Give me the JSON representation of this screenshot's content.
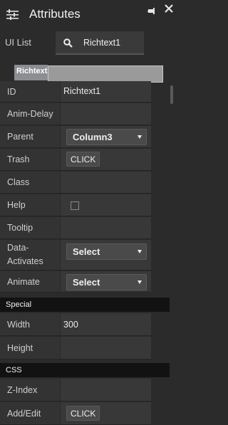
{
  "header": {
    "title": "Attributes"
  },
  "tabs": {
    "ui_list": "UI List",
    "search_value": "Richtext1"
  },
  "name_tag": "Richtext",
  "props": {
    "id": {
      "label": "ID",
      "value": "Richtext1"
    },
    "anim_delay": {
      "label": "Anim-Delay",
      "value": ""
    },
    "parent": {
      "label": "Parent",
      "value": "Column3"
    },
    "trash": {
      "label": "Trash",
      "button": "CLICK"
    },
    "class": {
      "label": "Class",
      "value": ""
    },
    "help": {
      "label": "Help",
      "checked": false
    },
    "tooltip": {
      "label": "Tooltip",
      "value": ""
    },
    "data_activates": {
      "label_line1": "Data-",
      "label_line2": "Activates",
      "value": "Select"
    },
    "animate": {
      "label": "Animate",
      "value": "Select"
    }
  },
  "special": {
    "title": "Special",
    "width": {
      "label": "Width",
      "value": "300"
    },
    "height": {
      "label": "Height",
      "value": ""
    }
  },
  "css": {
    "title": "CSS",
    "z_index": {
      "label": "Z-Index",
      "value": ""
    },
    "add_edit": {
      "label": "Add/Edit",
      "button": "CLICK"
    }
  },
  "icons": {
    "header": "sliders-icon",
    "search": "search-icon",
    "pin": "pin-icon",
    "close": "close-icon"
  }
}
